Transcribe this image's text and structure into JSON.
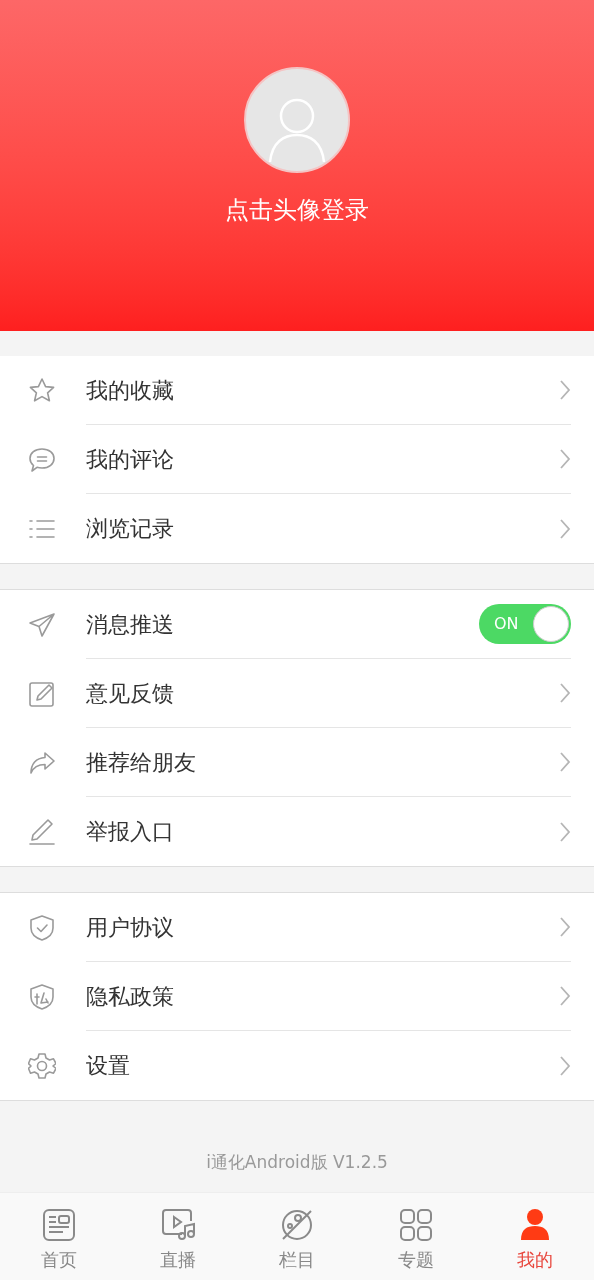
{
  "header": {
    "login_prompt": "点击头像登录"
  },
  "groups": [
    {
      "items": [
        {
          "kind": "link",
          "label": "我的收藏"
        },
        {
          "kind": "link",
          "label": "我的评论"
        },
        {
          "kind": "link",
          "label": "浏览记录"
        }
      ]
    },
    {
      "items": [
        {
          "kind": "toggle",
          "label": "消息推送",
          "on": true,
          "toggle_text": "ON"
        },
        {
          "kind": "link",
          "label": "意见反馈"
        },
        {
          "kind": "link",
          "label": "推荐给朋友"
        },
        {
          "kind": "link",
          "label": "举报入口"
        }
      ]
    },
    {
      "items": [
        {
          "kind": "link",
          "label": "用户协议"
        },
        {
          "kind": "link",
          "label": "隐私政策"
        },
        {
          "kind": "link",
          "label": "设置"
        }
      ]
    }
  ],
  "version": "i通化Android版 V1.2.5",
  "tabs": [
    {
      "label": "首页",
      "selected": false
    },
    {
      "label": "直播",
      "selected": false
    },
    {
      "label": "栏目",
      "selected": false
    },
    {
      "label": "专题",
      "selected": false
    },
    {
      "label": "我的",
      "selected": true
    }
  ]
}
